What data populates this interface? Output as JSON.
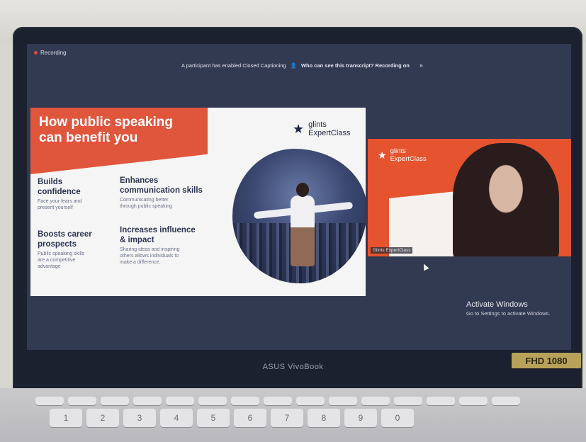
{
  "zoom_bar": {
    "recording_label": "Recording"
  },
  "caption_bar": {
    "notice": "A participant has enabled Closed Captioning",
    "transcript_question": "Who can see this transcript? Recording on"
  },
  "slide": {
    "title_line1": "How public speaking",
    "title_line2": "can benefit you",
    "brand_line1": "glints",
    "brand_line2": "ExpertClass",
    "points": [
      {
        "heading_line1": "Builds",
        "heading_line2": "confidence",
        "desc_line1": "Face your fears and",
        "desc_line2": "present yourself"
      },
      {
        "heading_line1": "Enhances",
        "heading_line2": "communication skills",
        "desc_line1": "Communicating better",
        "desc_line2": "through public speaking"
      },
      {
        "heading_line1": "Boosts career",
        "heading_line2": "prospects",
        "desc_line1": "Public speaking skills",
        "desc_line2": "are a competitive",
        "desc_line3": "advantage"
      },
      {
        "heading_line1": "Increases influence",
        "heading_line2": "& impact",
        "desc_line1": "Sharing ideas and inspiring",
        "desc_line2": "others allows individuals to",
        "desc_line3": "make a difference."
      }
    ]
  },
  "video_tile": {
    "brand_line1": "glints",
    "brand_line2": "ExpertClass",
    "participant_name": "Glints ExpertClass"
  },
  "activation": {
    "title": "Activate Windows",
    "subtitle": "Go to Settings to activate Windows."
  },
  "laptop": {
    "brand": "ASUS VivoBook",
    "badge": "FHD 1080"
  },
  "keyboard": {
    "number_row": [
      "1",
      "2",
      "3",
      "4",
      "5",
      "6",
      "7",
      "8",
      "9",
      "0"
    ]
  },
  "colors": {
    "accent_orange": "#e0563d",
    "meeting_bg": "#323a52",
    "slide_text": "#2d3452"
  }
}
